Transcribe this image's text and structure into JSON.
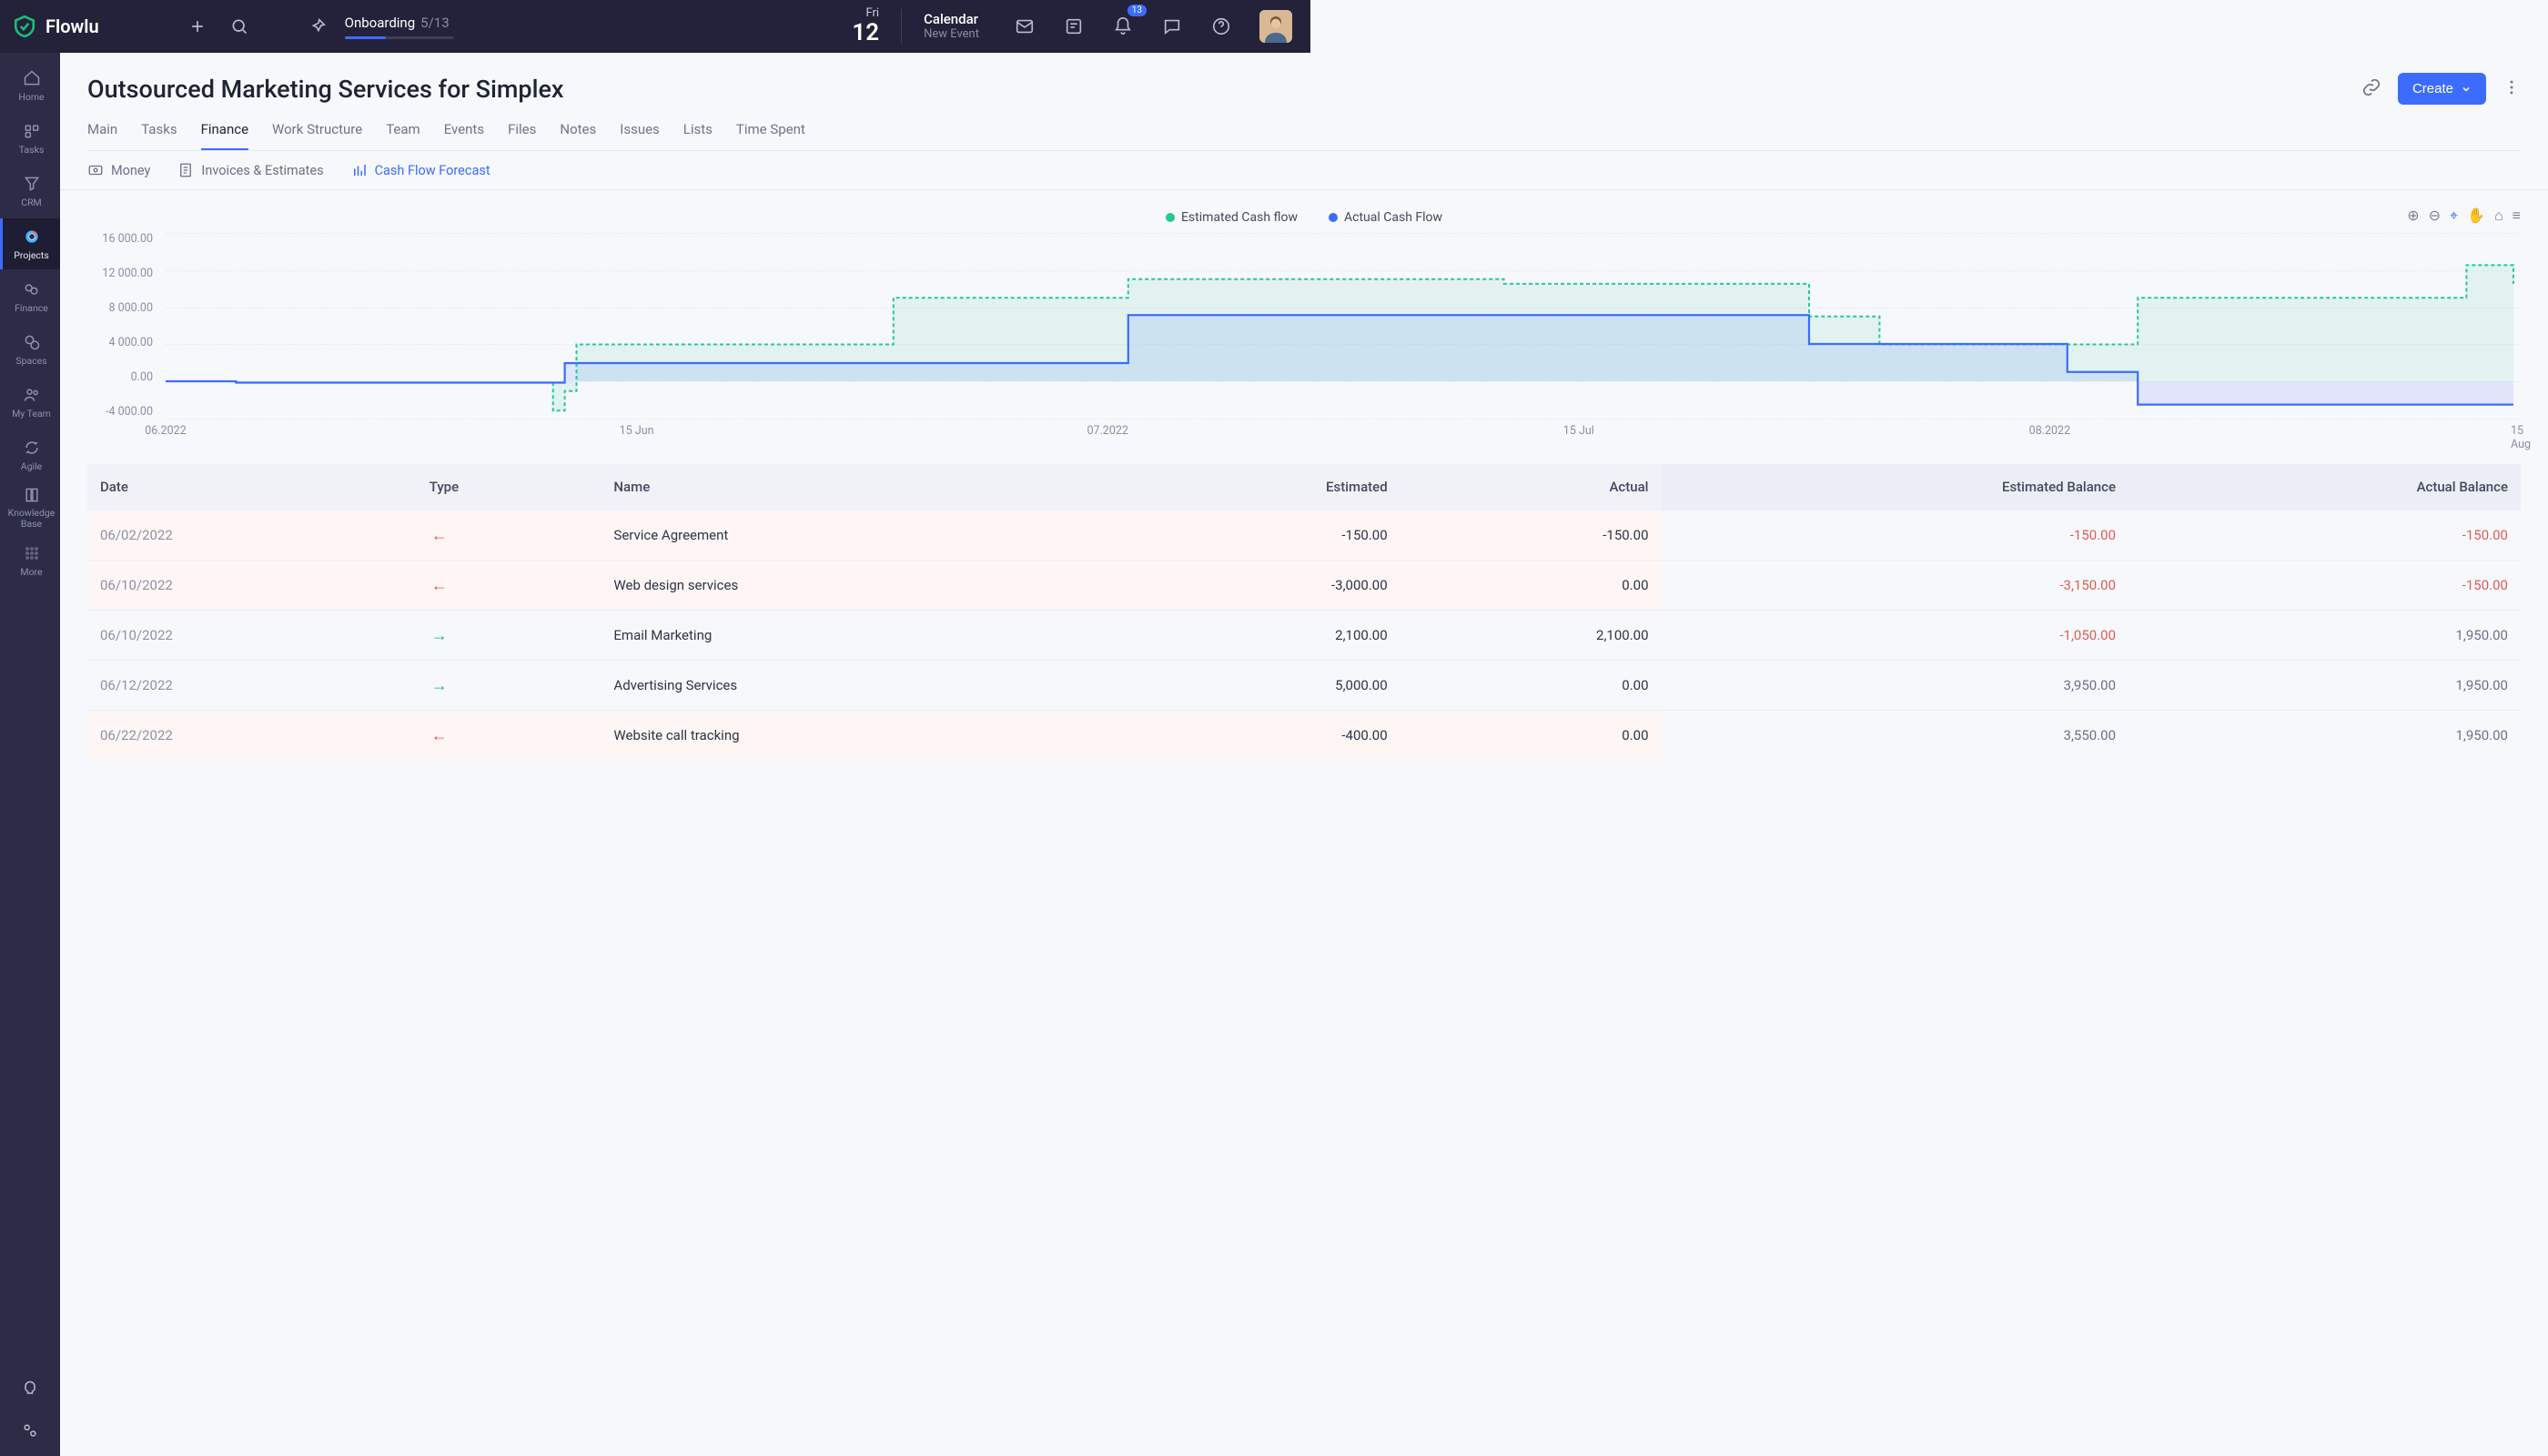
{
  "brand": "Flowlu",
  "onboarding": {
    "label": "Onboarding",
    "progress": "5/13"
  },
  "date": {
    "dow": "Fri",
    "day": "12"
  },
  "calendar": {
    "title": "Calendar",
    "subtitle": "New Event"
  },
  "notifications": {
    "count": "13"
  },
  "sidebar": [
    {
      "label": "Home"
    },
    {
      "label": "Tasks"
    },
    {
      "label": "CRM"
    },
    {
      "label": "Projects",
      "active": true
    },
    {
      "label": "Finance"
    },
    {
      "label": "Spaces"
    },
    {
      "label": "My Team"
    },
    {
      "label": "Agile"
    },
    {
      "label": "Knowledge Base"
    },
    {
      "label": "More"
    }
  ],
  "page": {
    "title": "Outsourced Marketing Services for Simplex",
    "create": "Create"
  },
  "tabs": [
    "Main",
    "Tasks",
    "Finance",
    "Work Structure",
    "Team",
    "Events",
    "Files",
    "Notes",
    "Issues",
    "Lists",
    "Time Spent"
  ],
  "active_tab": 2,
  "subtabs": [
    {
      "label": "Money"
    },
    {
      "label": "Invoices & Estimates"
    },
    {
      "label": "Cash Flow Forecast",
      "active": true
    }
  ],
  "chart_legend": {
    "estimated": "Estimated Cash flow",
    "actual": "Actual Cash Flow"
  },
  "chart_data": {
    "type": "line",
    "title": "",
    "xlabel": "",
    "ylabel": "",
    "ylim": [
      -4000,
      16000
    ],
    "y_ticks": [
      "16 000.00",
      "12 000.00",
      "8 000.00",
      "4 000.00",
      "0.00",
      "-4 000.00"
    ],
    "x_ticks": [
      "06.2022",
      "15 Jun",
      "07.2022",
      "15 Jul",
      "08.2022",
      "15 Aug"
    ],
    "x": [
      0,
      0.03,
      0.1,
      0.165,
      0.17,
      0.175,
      0.29,
      0.31,
      0.4,
      0.41,
      0.56,
      0.57,
      0.695,
      0.7,
      0.72,
      0.73,
      0.75,
      0.81,
      0.82,
      0.84,
      0.97,
      0.98,
      1.0
    ],
    "series": [
      {
        "name": "Estimated Cash flow",
        "values": [
          0,
          -150,
          -150,
          -3150,
          -1050,
          3950,
          3950,
          8950,
          8950,
          10950,
          10950,
          10450,
          10450,
          6950,
          6950,
          3950,
          3950,
          3950,
          3950,
          8950,
          8950,
          12450,
          10450
        ]
      },
      {
        "name": "Actual Cash Flow",
        "values": [
          0,
          -150,
          -150,
          -150,
          1950,
          1950,
          1950,
          1950,
          1950,
          7100,
          7100,
          7100,
          7100,
          4000,
          4000,
          4000,
          4000,
          1000,
          1000,
          -2500,
          -2500,
          -2500,
          -2500
        ]
      }
    ],
    "legend_position": "top-center",
    "grid": true
  },
  "table": {
    "headers": [
      "Date",
      "Type",
      "Name",
      "Estimated",
      "Actual",
      "Estimated Balance",
      "Actual Balance"
    ],
    "rows": [
      {
        "date": "06/02/2022",
        "type": "out",
        "name": "Service Agreement",
        "estimated": "-150.00",
        "actual": "-150.00",
        "ebal": "-150.00",
        "abal": "-150.00",
        "ebal_neg": true,
        "abal_neg": true
      },
      {
        "date": "06/10/2022",
        "type": "out",
        "name": "Web design services",
        "estimated": "-3,000.00",
        "actual": "0.00",
        "ebal": "-3,150.00",
        "abal": "-150.00",
        "ebal_neg": true,
        "abal_neg": true
      },
      {
        "date": "06/10/2022",
        "type": "in",
        "name": "Email Marketing",
        "estimated": "2,100.00",
        "actual": "2,100.00",
        "ebal": "-1,050.00",
        "abal": "1,950.00",
        "ebal_neg": true,
        "abal_neg": false
      },
      {
        "date": "06/12/2022",
        "type": "in",
        "name": "Advertising Services",
        "estimated": "5,000.00",
        "actual": "0.00",
        "ebal": "3,950.00",
        "abal": "1,950.00",
        "ebal_neg": false,
        "abal_neg": false
      },
      {
        "date": "06/22/2022",
        "type": "out",
        "name": "Website call tracking",
        "estimated": "-400.00",
        "actual": "0.00",
        "ebal": "3,550.00",
        "abal": "1,950.00",
        "ebal_neg": false,
        "abal_neg": false
      }
    ]
  }
}
